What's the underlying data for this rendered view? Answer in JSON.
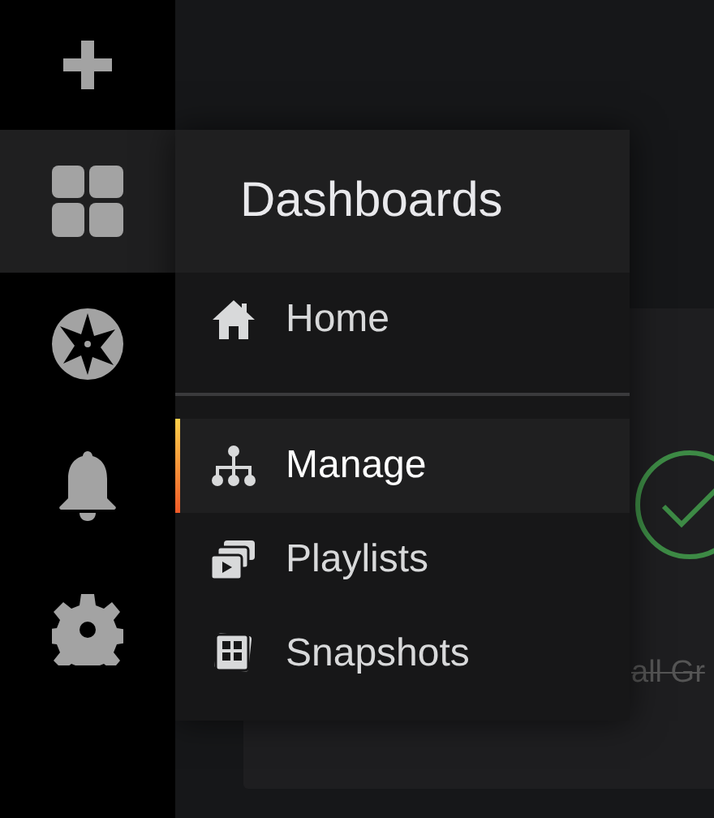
{
  "sidebar": {
    "items": [
      {
        "selected": false
      },
      {
        "selected": true
      },
      {
        "selected": false
      },
      {
        "selected": false
      },
      {
        "selected": false
      }
    ]
  },
  "menu": {
    "title": "Dashboards",
    "sections": [
      {
        "items": [
          {
            "label": "Home",
            "selected": false
          }
        ]
      },
      {
        "items": [
          {
            "label": "Manage",
            "selected": true
          },
          {
            "label": "Playlists",
            "selected": false
          },
          {
            "label": "Snapshots",
            "selected": false
          }
        ]
      }
    ]
  },
  "panel": {
    "text": "all Gr"
  }
}
